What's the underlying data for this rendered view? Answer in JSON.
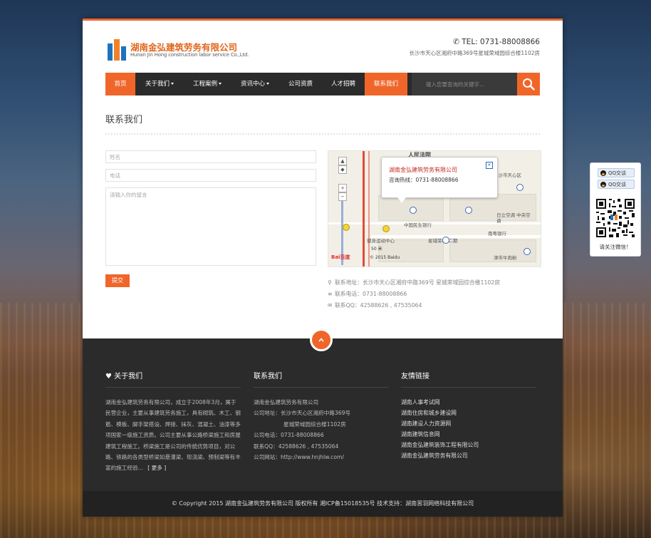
{
  "header": {
    "logo_cn": "湖南金弘建筑劳务有限公司",
    "logo_en": "Hunan Jin Hong construction labor service Co.,Ltd.",
    "tel": "TEL: 0731-88008866",
    "address": "长沙市天心区湘府中路369号星城荣域园综合楼1102房"
  },
  "nav": {
    "items": [
      {
        "label": "首页",
        "active": true
      },
      {
        "label": "关于我们",
        "dropdown": true
      },
      {
        "label": "工程案例",
        "dropdown": true
      },
      {
        "label": "资讯中心",
        "dropdown": true
      },
      {
        "label": "公司资质"
      },
      {
        "label": "人才招聘"
      },
      {
        "label": "联系我们",
        "active": true
      }
    ],
    "search_placeholder": "输入您要查询的关键字...",
    "search_icon": "search-icon"
  },
  "contact": {
    "title": "联系我们",
    "form": {
      "name_placeholder": "姓名",
      "phone_placeholder": "电话",
      "message_placeholder": "请输入你的留言",
      "submit_label": "提交"
    },
    "map": {
      "bubble_title": "湖南金弘建筑劳务有限公司",
      "bubble_phone": "咨询热线：0731-88008866",
      "labels": {
        "top": "人民法院",
        "bank": "中国民生银行",
        "mall": "星城荣域-二期",
        "market": "南粤银行",
        "plaza": "日立空调 中央空调",
        "station": "湘府路口",
        "school": "中沙市天心区",
        "food": "津市牛肉粉",
        "health": "健身运动中心"
      },
      "scale": "50 米",
      "copyright": "© 2015 Baidu",
      "brand": "Bai百度"
    },
    "address": "联系地址：长沙市天心区湘府中路369号 星城荣域园综合楼1102房",
    "phone": "联系电话：0731-88008866",
    "qq": "联系QQ：42588626 , 47535064"
  },
  "footer": {
    "about": {
      "title": "关于我们",
      "text": "湖南金弘建筑劳务有限公司，成立于2008年3月，属于民营企业，主要从事建筑劳务施工，具有砌筑、木工、钢筋、模板、脚手架搭设、焊接、抹灰、混凝土、油漆等多项国家一级施工资质。公司主要从事公路桥梁施工和房屋建筑工程施工。桥梁施工是公司的传统优势项目，对公路、铁路的各类型桥梁如悬灌梁、现浇梁、预制梁等有丰富的施工经验...",
      "more": "[ 更多 ]"
    },
    "contact": {
      "title": "联系我们",
      "company": "湖南金弘建筑劳务有限公司",
      "address_label": "公司地址：",
      "address_line1": "长沙市天心区湘府中路369号",
      "address_line2": "星城荣域园综合楼1102房",
      "phone": "公司电话：0731-88008866",
      "qq": "联系QQ：42588626 , 47535064",
      "website": "公司网站：http://www.hnjhlw.com/"
    },
    "links": {
      "title": "友情链接",
      "items": [
        "湖南人事考试网",
        "湖南住房和城乡建设网",
        "湖南建设人力资源网",
        "湖南建筑信息网",
        "湖南金弘建筑装饰工程有限公司",
        "湖南金弘建筑劳务有限公司"
      ]
    },
    "copyright": "© Copyright 2015  湖南金弘建筑劳务有限公司 版权所有  湘ICP备15018535号    技术支持：湖南習羽网络科技有限公司"
  },
  "sidebar": {
    "qq1": "QQ交谈",
    "qq2": "QQ交谈",
    "caption": "请关注微信！"
  },
  "colors": {
    "accent": "#f0662a",
    "nav_bg": "#2b2b2b",
    "footer_bg": "#2b2b2b"
  }
}
